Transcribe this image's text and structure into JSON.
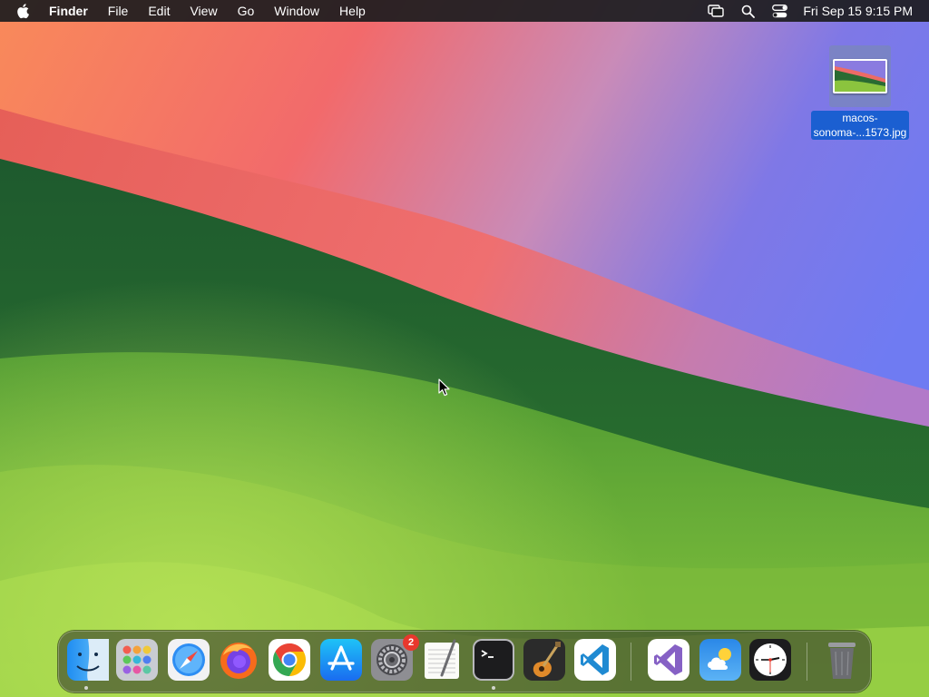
{
  "menubar": {
    "app_name": "Finder",
    "menus": [
      "File",
      "Edit",
      "View",
      "Go",
      "Window",
      "Help"
    ],
    "status_icons": [
      "screen-mirroring-icon",
      "spotlight-search-icon",
      "control-center-icon"
    ],
    "clock": "Fri Sep 15  9:15 PM"
  },
  "desktop": {
    "file_icon": {
      "label_line1": "macos-",
      "label_line2": "sonoma-...1573.jpg",
      "selected": true
    }
  },
  "dock": {
    "apps": [
      {
        "name": "Finder",
        "icon": "finder-icon",
        "running": true
      },
      {
        "name": "Launchpad",
        "icon": "launchpad-icon",
        "running": false
      },
      {
        "name": "Safari",
        "icon": "safari-icon",
        "running": false
      },
      {
        "name": "Firefox",
        "icon": "firefox-icon",
        "running": false
      },
      {
        "name": "Google Chrome",
        "icon": "chrome-icon",
        "running": false
      },
      {
        "name": "App Store",
        "icon": "app-store-icon",
        "running": false
      },
      {
        "name": "System Settings",
        "icon": "system-settings-icon",
        "running": false,
        "badge": "2"
      },
      {
        "name": "TextEdit",
        "icon": "textedit-icon",
        "running": false
      },
      {
        "name": "Terminal",
        "icon": "terminal-icon",
        "running": true
      },
      {
        "name": "GarageBand",
        "icon": "garageband-icon",
        "running": false
      },
      {
        "name": "Visual Studio Code",
        "icon": "vscode-icon",
        "running": false
      },
      {
        "name": "Visual Studio",
        "icon": "visual-studio-icon",
        "running": false
      },
      {
        "name": "Weather",
        "icon": "weather-icon",
        "running": false
      },
      {
        "name": "Clock",
        "icon": "clock-icon",
        "running": false
      },
      {
        "name": "Trash",
        "icon": "trash-icon",
        "running": false
      }
    ]
  },
  "colors": {
    "selection_blue": "#1b5fd1",
    "badge_red": "#e8382d",
    "menubar_bg": "#1c1c1e"
  }
}
